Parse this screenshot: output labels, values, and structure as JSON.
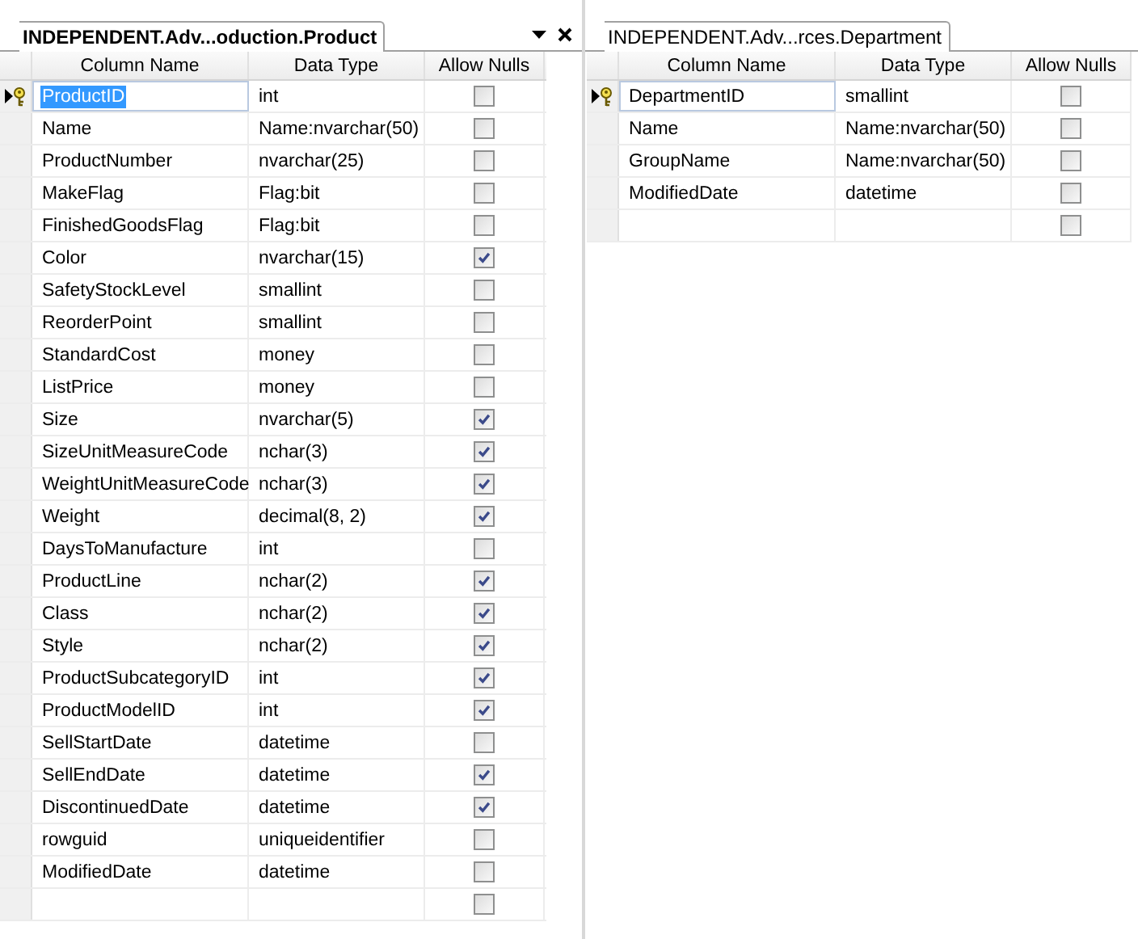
{
  "panes": [
    {
      "tab": "INDEPENDENT.Adv...oduction.Product",
      "active": true,
      "columns": [
        "Column Name",
        "Data Type",
        "Allow Nulls"
      ],
      "rows": [
        {
          "name": "ProductID",
          "type": "int",
          "allow_nulls": false,
          "primary_key": true,
          "selected": true
        },
        {
          "name": "Name",
          "type": "Name:nvarchar(50)",
          "allow_nulls": false,
          "primary_key": false,
          "selected": false
        },
        {
          "name": "ProductNumber",
          "type": "nvarchar(25)",
          "allow_nulls": false,
          "primary_key": false,
          "selected": false
        },
        {
          "name": "MakeFlag",
          "type": "Flag:bit",
          "allow_nulls": false,
          "primary_key": false,
          "selected": false
        },
        {
          "name": "FinishedGoodsFlag",
          "type": "Flag:bit",
          "allow_nulls": false,
          "primary_key": false,
          "selected": false
        },
        {
          "name": "Color",
          "type": "nvarchar(15)",
          "allow_nulls": true,
          "primary_key": false,
          "selected": false
        },
        {
          "name": "SafetyStockLevel",
          "type": "smallint",
          "allow_nulls": false,
          "primary_key": false,
          "selected": false
        },
        {
          "name": "ReorderPoint",
          "type": "smallint",
          "allow_nulls": false,
          "primary_key": false,
          "selected": false
        },
        {
          "name": "StandardCost",
          "type": "money",
          "allow_nulls": false,
          "primary_key": false,
          "selected": false
        },
        {
          "name": "ListPrice",
          "type": "money",
          "allow_nulls": false,
          "primary_key": false,
          "selected": false
        },
        {
          "name": "Size",
          "type": "nvarchar(5)",
          "allow_nulls": true,
          "primary_key": false,
          "selected": false
        },
        {
          "name": "SizeUnitMeasureCode",
          "type": "nchar(3)",
          "allow_nulls": true,
          "primary_key": false,
          "selected": false
        },
        {
          "name": "WeightUnitMeasureCode",
          "type": "nchar(3)",
          "allow_nulls": true,
          "primary_key": false,
          "selected": false
        },
        {
          "name": "Weight",
          "type": "decimal(8, 2)",
          "allow_nulls": true,
          "primary_key": false,
          "selected": false
        },
        {
          "name": "DaysToManufacture",
          "type": "int",
          "allow_nulls": false,
          "primary_key": false,
          "selected": false
        },
        {
          "name": "ProductLine",
          "type": "nchar(2)",
          "allow_nulls": true,
          "primary_key": false,
          "selected": false
        },
        {
          "name": "Class",
          "type": "nchar(2)",
          "allow_nulls": true,
          "primary_key": false,
          "selected": false
        },
        {
          "name": "Style",
          "type": "nchar(2)",
          "allow_nulls": true,
          "primary_key": false,
          "selected": false
        },
        {
          "name": "ProductSubcategoryID",
          "type": "int",
          "allow_nulls": true,
          "primary_key": false,
          "selected": false
        },
        {
          "name": "ProductModelID",
          "type": "int",
          "allow_nulls": true,
          "primary_key": false,
          "selected": false
        },
        {
          "name": "SellStartDate",
          "type": "datetime",
          "allow_nulls": false,
          "primary_key": false,
          "selected": false
        },
        {
          "name": "SellEndDate",
          "type": "datetime",
          "allow_nulls": true,
          "primary_key": false,
          "selected": false
        },
        {
          "name": "DiscontinuedDate",
          "type": "datetime",
          "allow_nulls": true,
          "primary_key": false,
          "selected": false
        },
        {
          "name": "rowguid",
          "type": "uniqueidentifier",
          "allow_nulls": false,
          "primary_key": false,
          "selected": false
        },
        {
          "name": "ModifiedDate",
          "type": "datetime",
          "allow_nulls": false,
          "primary_key": false,
          "selected": false
        }
      ],
      "new_row": {
        "allow_nulls": false
      }
    },
    {
      "tab": "INDEPENDENT.Adv...rces.Department",
      "active": false,
      "columns": [
        "Column Name",
        "Data Type",
        "Allow Nulls"
      ],
      "rows": [
        {
          "name": "DepartmentID",
          "type": "smallint",
          "allow_nulls": false,
          "primary_key": true,
          "selected": true
        },
        {
          "name": "Name",
          "type": "Name:nvarchar(50)",
          "allow_nulls": false,
          "primary_key": false,
          "selected": false
        },
        {
          "name": "GroupName",
          "type": "Name:nvarchar(50)",
          "allow_nulls": false,
          "primary_key": false,
          "selected": false
        },
        {
          "name": "ModifiedDate",
          "type": "datetime",
          "allow_nulls": false,
          "primary_key": false,
          "selected": false
        }
      ],
      "new_row": {
        "allow_nulls": false
      }
    }
  ]
}
